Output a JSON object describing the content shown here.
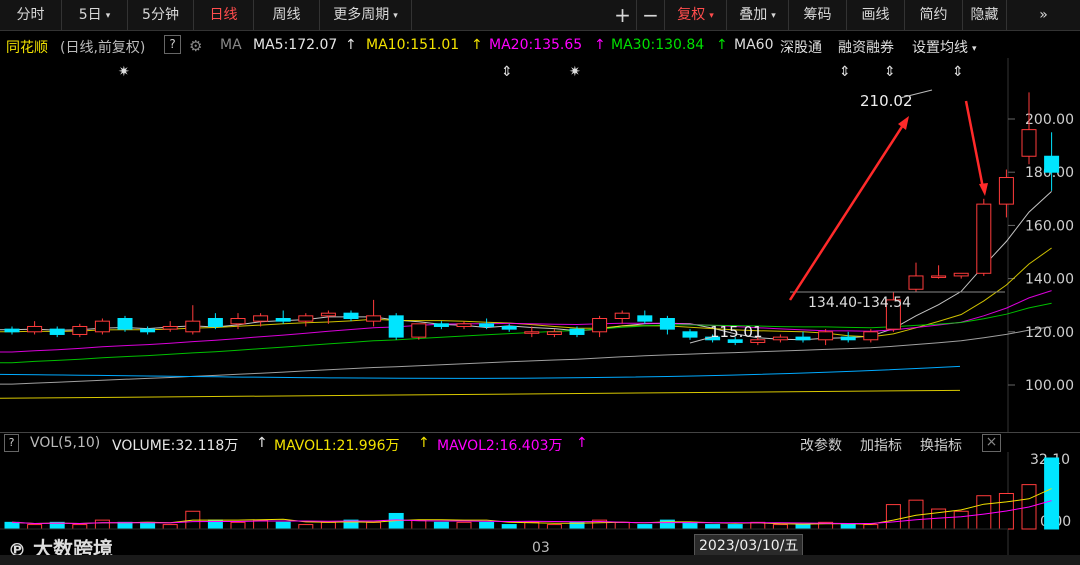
{
  "toolbar": {
    "tabs": [
      {
        "label": "分时",
        "active": false,
        "dropdown": false
      },
      {
        "label": "5日",
        "active": false,
        "dropdown": true
      },
      {
        "label": "5分钟",
        "active": false,
        "dropdown": false
      },
      {
        "label": "日线",
        "active": true,
        "dropdown": false
      },
      {
        "label": "周线",
        "active": false,
        "dropdown": false
      },
      {
        "label": "更多周期",
        "active": false,
        "dropdown": true
      }
    ],
    "right": [
      {
        "label": "+",
        "dropdown": false
      },
      {
        "label": "−",
        "dropdown": false
      },
      {
        "label": "复权",
        "dropdown": true,
        "accent": true
      },
      {
        "label": "叠加",
        "dropdown": true
      },
      {
        "label": "筹码",
        "dropdown": false
      },
      {
        "label": "画线",
        "dropdown": false
      },
      {
        "label": "简约",
        "dropdown": false
      },
      {
        "label": "隐藏",
        "dropdown": false
      }
    ],
    "expand_icon": "»"
  },
  "indicator": {
    "brand": "同花顺",
    "mode": "(日线,前复权)",
    "help": "?",
    "ma_label": "MA",
    "ma5": "MA5:172.07",
    "ma10": "MA10:151.01",
    "ma20": "MA20:135.65",
    "ma30": "MA30:130.84",
    "ma60": "MA60",
    "tags": [
      "深股通",
      "融资融券"
    ],
    "setting": "设置均线"
  },
  "price_chart": {
    "y_ticks": [
      "200.00",
      "180.00",
      "160.00",
      "140.00",
      "120.00",
      "100.00"
    ],
    "annotation_high": "210.02",
    "annotation_mid": "134.40-134.54",
    "annotation_low": "115.01"
  },
  "volume": {
    "label": "VOL(5,10)",
    "volume": "VOLUME:32.118万",
    "mavol1": "MAVOL1:21.996万",
    "mavol2": "MAVOL2:16.403万",
    "actions": [
      "改参数",
      "加指标",
      "换指标"
    ],
    "close": "×",
    "y_ticks": [
      "32.10",
      "0.00"
    ]
  },
  "x_axis": {
    "month_label": "03",
    "cursor_date": "2023/03/10/五"
  },
  "watermark": "大数跨境",
  "colors": {
    "up": "#ff3b3b",
    "down": "#00e5ff",
    "ma5": "#e6e6e6",
    "ma10": "#f2e200",
    "ma20": "#ff00ff",
    "ma30": "#00e000",
    "ma60": "#bbbbbb",
    "accent": "#ff4d4d"
  },
  "chart_data": {
    "type": "candlestick",
    "ylim": [
      90,
      215
    ],
    "candles": [
      {
        "o": 121,
        "h": 122,
        "l": 119,
        "c": 120
      },
      {
        "o": 120,
        "h": 124,
        "l": 119,
        "c": 122
      },
      {
        "o": 121,
        "h": 122,
        "l": 118,
        "c": 119
      },
      {
        "o": 119,
        "h": 123,
        "l": 118,
        "c": 122
      },
      {
        "o": 120,
        "h": 125,
        "l": 119,
        "c": 124
      },
      {
        "o": 125,
        "h": 126,
        "l": 120,
        "c": 121
      },
      {
        "o": 121,
        "h": 122,
        "l": 119,
        "c": 120
      },
      {
        "o": 121,
        "h": 124,
        "l": 120,
        "c": 122
      },
      {
        "o": 120,
        "h": 130,
        "l": 119,
        "c": 124
      },
      {
        "o": 125,
        "h": 127,
        "l": 121,
        "c": 122
      },
      {
        "o": 123,
        "h": 127,
        "l": 121,
        "c": 125
      },
      {
        "o": 124,
        "h": 127,
        "l": 122,
        "c": 126
      },
      {
        "o": 125,
        "h": 128,
        "l": 123,
        "c": 124
      },
      {
        "o": 124,
        "h": 127,
        "l": 122,
        "c": 126
      },
      {
        "o": 126,
        "h": 128,
        "l": 123,
        "c": 127
      },
      {
        "o": 127,
        "h": 128,
        "l": 124,
        "c": 125
      },
      {
        "o": 124,
        "h": 132,
        "l": 122,
        "c": 126
      },
      {
        "o": 126,
        "h": 127,
        "l": 117,
        "c": 118
      },
      {
        "o": 118,
        "h": 123,
        "l": 117,
        "c": 123
      },
      {
        "o": 123,
        "h": 124,
        "l": 121,
        "c": 122
      },
      {
        "o": 122,
        "h": 124,
        "l": 121,
        "c": 123
      },
      {
        "o": 123,
        "h": 125,
        "l": 121,
        "c": 122
      },
      {
        "o": 122,
        "h": 123,
        "l": 120,
        "c": 121
      },
      {
        "o": 120,
        "h": 122,
        "l": 118,
        "c": 120
      },
      {
        "o": 119,
        "h": 121,
        "l": 118,
        "c": 120
      },
      {
        "o": 121,
        "h": 122,
        "l": 118,
        "c": 119
      },
      {
        "o": 120,
        "h": 126,
        "l": 118,
        "c": 125
      },
      {
        "o": 125,
        "h": 128,
        "l": 123,
        "c": 127
      },
      {
        "o": 126,
        "h": 128,
        "l": 123,
        "c": 124
      },
      {
        "o": 125,
        "h": 126,
        "l": 119,
        "c": 121
      },
      {
        "o": 120,
        "h": 121,
        "l": 117,
        "c": 118
      },
      {
        "o": 118,
        "h": 119,
        "l": 116,
        "c": 117
      },
      {
        "o": 117,
        "h": 118,
        "l": 115,
        "c": 116
      },
      {
        "o": 116,
        "h": 118,
        "l": 115,
        "c": 117
      },
      {
        "o": 117,
        "h": 119,
        "l": 116,
        "c": 118
      },
      {
        "o": 118,
        "h": 120,
        "l": 116,
        "c": 117
      },
      {
        "o": 117,
        "h": 121,
        "l": 115,
        "c": 120
      },
      {
        "o": 118,
        "h": 120,
        "l": 116,
        "c": 117
      },
      {
        "o": 117,
        "h": 121,
        "l": 116,
        "c": 120
      },
      {
        "o": 121,
        "h": 135,
        "l": 120,
        "c": 132
      },
      {
        "o": 136,
        "h": 146,
        "l": 135,
        "c": 141
      },
      {
        "o": 141,
        "h": 145,
        "l": 140,
        "c": 141
      },
      {
        "o": 141,
        "h": 142,
        "l": 140,
        "c": 142
      },
      {
        "o": 142,
        "h": 170,
        "l": 141,
        "c": 168
      },
      {
        "o": 168,
        "h": 181,
        "l": 163,
        "c": 178
      },
      {
        "o": 186,
        "h": 210,
        "l": 183,
        "c": 196
      },
      {
        "o": 186,
        "h": 195,
        "l": 173,
        "c": 180
      }
    ],
    "volumes": [
      3,
      2,
      3,
      2,
      4,
      3,
      3,
      2,
      8,
      4,
      3,
      4,
      3,
      2,
      3,
      4,
      3,
      7,
      4,
      3,
      3,
      3,
      2,
      3,
      2,
      3,
      4,
      3,
      2,
      4,
      3,
      2,
      2,
      3,
      2,
      2,
      3,
      2,
      2,
      11,
      13,
      9,
      8,
      15,
      16,
      20,
      32
    ]
  }
}
